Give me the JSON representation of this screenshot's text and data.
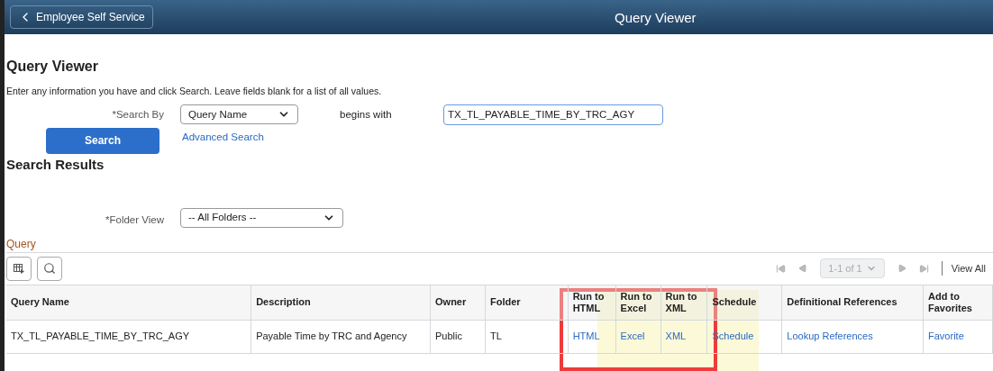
{
  "header": {
    "back_button": "Employee Self Service",
    "title": "Query Viewer"
  },
  "page_title": "Query Viewer",
  "instructions": "Enter any information you have and click Search. Leave fields blank for a list of all values.",
  "search_by": {
    "label": "*Search By",
    "value": "Query Name",
    "operator": "begins with",
    "query": "TX_TL_PAYABLE_TIME_BY_TRC_AGY"
  },
  "search_button": "Search",
  "advanced_search_link": "Advanced Search",
  "results_title": "Search Results",
  "folder_view": {
    "label": "*Folder View",
    "value": "-- All Folders --"
  },
  "grid": {
    "title": "Query",
    "pager": "1-1 of 1",
    "view_all": "View All",
    "columns": [
      {
        "label": "Query Name"
      },
      {
        "label": "Description"
      },
      {
        "label": "Owner"
      },
      {
        "label": "Folder"
      },
      {
        "label": "Run to HTML"
      },
      {
        "label": "Run to Excel"
      },
      {
        "label": "Run to XML"
      },
      {
        "label": "Schedule"
      },
      {
        "label": "Definitional References"
      },
      {
        "label": "Add to Favorites"
      }
    ],
    "rows": [
      {
        "cells": [
          {
            "text": "TX_TL_PAYABLE_TIME_BY_TRC_AGY",
            "kind": "text"
          },
          {
            "text": "Payable Time by TRC and Agency",
            "kind": "text"
          },
          {
            "text": "Public",
            "kind": "text"
          },
          {
            "text": "TL",
            "kind": "text"
          },
          {
            "text": "HTML",
            "kind": "link"
          },
          {
            "text": "Excel",
            "kind": "link"
          },
          {
            "text": "XML",
            "kind": "link"
          },
          {
            "text": "Schedule",
            "kind": "link"
          },
          {
            "text": "Lookup References",
            "kind": "link"
          },
          {
            "text": "Favorite",
            "kind": "link"
          }
        ]
      }
    ]
  }
}
